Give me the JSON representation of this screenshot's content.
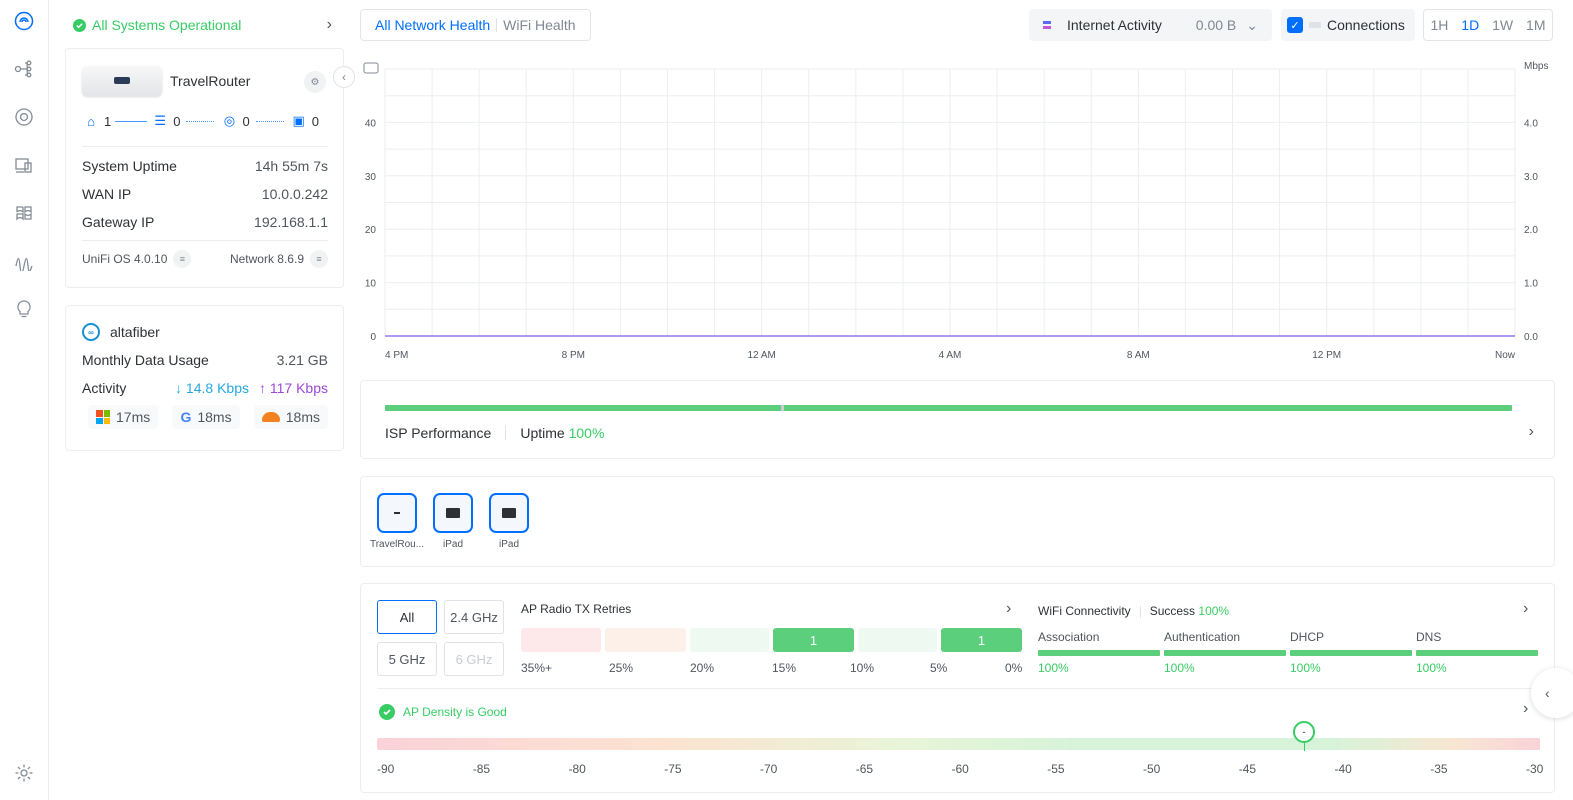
{
  "status": {
    "text": "All Systems Operational"
  },
  "device": {
    "name": "TravelRouter",
    "topology": [
      "1",
      "0",
      "0",
      "0"
    ],
    "stats": [
      {
        "label": "System Uptime",
        "value": "14h 55m 7s"
      },
      {
        "label": "WAN IP",
        "value": "10.0.0.242"
      },
      {
        "label": "Gateway IP",
        "value": "192.168.1.1"
      }
    ],
    "os_version": "UniFi OS 4.0.10",
    "network_version": "Network 8.6.9"
  },
  "isp": {
    "logo_text": "∞",
    "name": "altafiber",
    "data_label": "Monthly Data Usage",
    "data_value": "3.21 GB",
    "activity_label": "Activity",
    "down": "↓  14.8 Kbps",
    "up": "↑  117 Kbps",
    "pings": [
      {
        "provider": "microsoft",
        "value": "17ms"
      },
      {
        "provider": "google",
        "value": "18ms"
      },
      {
        "provider": "cloudflare",
        "value": "18ms"
      }
    ]
  },
  "tabs": [
    "All Network Health",
    "WiFi Health"
  ],
  "internet_activity": {
    "label": "Internet Activity",
    "value": "0.00 B"
  },
  "connections": {
    "label": "Connections",
    "checked": true
  },
  "ranges": [
    "1H",
    "1D",
    "1W",
    "1M"
  ],
  "chart_data": {
    "type": "line",
    "x": [
      "4 PM",
      "8 PM",
      "12 AM",
      "4 AM",
      "8 AM",
      "12 PM",
      "Now"
    ],
    "y_left": {
      "ticks": [
        0,
        10,
        20,
        30,
        40
      ],
      "range": [
        0,
        50
      ]
    },
    "y_right": {
      "label": "Mbps",
      "ticks": [
        "0.0",
        "1.0",
        "2.0",
        "3.0",
        "4.0"
      ],
      "range": [
        0,
        5
      ]
    },
    "series": [
      {
        "values": [
          0,
          0,
          0,
          0,
          0,
          0,
          0
        ],
        "color": "#7f5af0"
      }
    ],
    "grid": true
  },
  "isp_performance": {
    "label": "ISP Performance",
    "uptime_label": "Uptime",
    "uptime_value": "100%"
  },
  "clients": [
    {
      "label": "TravelRou..."
    },
    {
      "label": "iPad"
    },
    {
      "label": "iPad"
    }
  ],
  "bands": [
    "All",
    "2.4 GHz",
    "5 GHz",
    "6 GHz"
  ],
  "tx_retries": {
    "title": "AP Radio TX Retries",
    "labels": [
      "35%+",
      "25%",
      "20%",
      "15%",
      "10%",
      "5%",
      "0%"
    ],
    "blocks": [
      {
        "value": "",
        "color": "#fde8ea"
      },
      {
        "value": "",
        "color": "#fdf0e8"
      },
      {
        "value": "",
        "color": "#eefaf1"
      },
      {
        "value": "1",
        "color": "#5ccf7c"
      },
      {
        "value": "",
        "color": "#eefaf1"
      },
      {
        "value": "1",
        "color": "#5ccf7c"
      }
    ]
  },
  "wifi_connectivity": {
    "title": "WiFi Connectivity",
    "success_label": "Success",
    "success_value": "100%",
    "items": [
      {
        "name": "Association",
        "value": "100%"
      },
      {
        "name": "Authentication",
        "value": "100%"
      },
      {
        "name": "DHCP",
        "value": "100%"
      },
      {
        "name": "DNS",
        "value": "100%"
      }
    ]
  },
  "ap_density": {
    "label": "AP Density is Good",
    "scale": [
      "-90",
      "-85",
      "-80",
      "-75",
      "-70",
      "-65",
      "-60",
      "-55",
      "-50",
      "-45",
      "-40",
      "-35",
      "-30"
    ],
    "marker_value": -42,
    "marker_text": "-"
  }
}
